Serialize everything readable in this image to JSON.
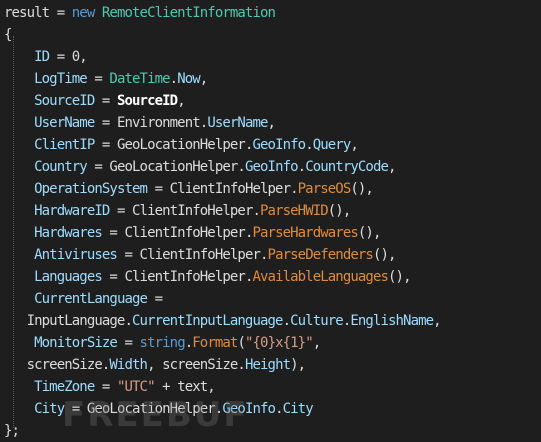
{
  "colors": {
    "background": "#1e1e1e",
    "plain": "#dcdcdc",
    "property": "#9cdcfe",
    "type": "#4ec9b0",
    "keyword": "#569cd6",
    "method": "#e08b3a",
    "string": "#d69d85"
  },
  "watermark": {
    "text": "FREEBUF",
    "style": "logo-watermark"
  },
  "code_lines": [
    [
      {
        "t": "result = ",
        "c": "plain"
      },
      {
        "t": "new",
        "c": "kw"
      },
      {
        "t": " ",
        "c": "plain"
      },
      {
        "t": "RemoteClientInformation",
        "c": "type"
      }
    ],
    [
      {
        "t": "{",
        "c": "plain"
      }
    ],
    [
      {
        "t": "    ",
        "c": "plain"
      },
      {
        "t": "ID",
        "c": "prop"
      },
      {
        "t": " = 0,",
        "c": "plain"
      }
    ],
    [
      {
        "t": "    ",
        "c": "plain"
      },
      {
        "t": "LogTime",
        "c": "prop"
      },
      {
        "t": " = ",
        "c": "plain"
      },
      {
        "t": "DateTime",
        "c": "type"
      },
      {
        "t": ".",
        "c": "plain"
      },
      {
        "t": "Now",
        "c": "prop"
      },
      {
        "t": ",",
        "c": "plain"
      }
    ],
    [
      {
        "t": "    ",
        "c": "plain"
      },
      {
        "t": "SourceID",
        "c": "prop"
      },
      {
        "t": " = ",
        "c": "plain"
      },
      {
        "t": "SourceID",
        "c": "bold"
      },
      {
        "t": ",",
        "c": "plain"
      }
    ],
    [
      {
        "t": "    ",
        "c": "plain"
      },
      {
        "t": "UserName",
        "c": "prop"
      },
      {
        "t": " = ",
        "c": "plain"
      },
      {
        "t": "Environment",
        "c": "plain"
      },
      {
        "t": ".",
        "c": "plain"
      },
      {
        "t": "UserName",
        "c": "prop"
      },
      {
        "t": ",",
        "c": "plain"
      }
    ],
    [
      {
        "t": "    ",
        "c": "plain"
      },
      {
        "t": "ClientIP",
        "c": "prop"
      },
      {
        "t": " = ",
        "c": "plain"
      },
      {
        "t": "GeoLocationHelper",
        "c": "plain"
      },
      {
        "t": ".",
        "c": "plain"
      },
      {
        "t": "GeoInfo",
        "c": "prop"
      },
      {
        "t": ".",
        "c": "plain"
      },
      {
        "t": "Query",
        "c": "prop"
      },
      {
        "t": ",",
        "c": "plain"
      }
    ],
    [
      {
        "t": "    ",
        "c": "plain"
      },
      {
        "t": "Country",
        "c": "prop"
      },
      {
        "t": " = ",
        "c": "plain"
      },
      {
        "t": "GeoLocationHelper",
        "c": "plain"
      },
      {
        "t": ".",
        "c": "plain"
      },
      {
        "t": "GeoInfo",
        "c": "prop"
      },
      {
        "t": ".",
        "c": "plain"
      },
      {
        "t": "CountryCode",
        "c": "prop"
      },
      {
        "t": ",",
        "c": "plain"
      }
    ],
    [
      {
        "t": "    ",
        "c": "plain"
      },
      {
        "t": "OperationSystem",
        "c": "prop"
      },
      {
        "t": " = ",
        "c": "plain"
      },
      {
        "t": "ClientInfoHelper",
        "c": "plain"
      },
      {
        "t": ".",
        "c": "plain"
      },
      {
        "t": "ParseOS",
        "c": "meth"
      },
      {
        "t": "(),",
        "c": "plain"
      }
    ],
    [
      {
        "t": "    ",
        "c": "plain"
      },
      {
        "t": "HardwareID",
        "c": "prop"
      },
      {
        "t": " = ",
        "c": "plain"
      },
      {
        "t": "ClientInfoHelper",
        "c": "plain"
      },
      {
        "t": ".",
        "c": "plain"
      },
      {
        "t": "ParseHWID",
        "c": "meth"
      },
      {
        "t": "(),",
        "c": "plain"
      }
    ],
    [
      {
        "t": "    ",
        "c": "plain"
      },
      {
        "t": "Hardwares",
        "c": "prop"
      },
      {
        "t": " = ",
        "c": "plain"
      },
      {
        "t": "ClientInfoHelper",
        "c": "plain"
      },
      {
        "t": ".",
        "c": "plain"
      },
      {
        "t": "ParseHardwares",
        "c": "meth"
      },
      {
        "t": "(),",
        "c": "plain"
      }
    ],
    [
      {
        "t": "    ",
        "c": "plain"
      },
      {
        "t": "Antiviruses",
        "c": "prop"
      },
      {
        "t": " = ",
        "c": "plain"
      },
      {
        "t": "ClientInfoHelper",
        "c": "plain"
      },
      {
        "t": ".",
        "c": "plain"
      },
      {
        "t": "ParseDefenders",
        "c": "meth"
      },
      {
        "t": "(),",
        "c": "plain"
      }
    ],
    [
      {
        "t": "    ",
        "c": "plain"
      },
      {
        "t": "Languages",
        "c": "prop"
      },
      {
        "t": " = ",
        "c": "plain"
      },
      {
        "t": "ClientInfoHelper",
        "c": "plain"
      },
      {
        "t": ".",
        "c": "plain"
      },
      {
        "t": "AvailableLanguages",
        "c": "meth"
      },
      {
        "t": "(),",
        "c": "plain"
      }
    ],
    [
      {
        "t": "    ",
        "c": "plain"
      },
      {
        "t": "CurrentLanguage",
        "c": "prop"
      },
      {
        "t": " =",
        "c": "plain"
      }
    ],
    [
      {
        "t": "   InputLanguage",
        "c": "plain"
      },
      {
        "t": ".",
        "c": "plain"
      },
      {
        "t": "CurrentInputLanguage",
        "c": "prop"
      },
      {
        "t": ".",
        "c": "plain"
      },
      {
        "t": "Culture",
        "c": "prop"
      },
      {
        "t": ".",
        "c": "plain"
      },
      {
        "t": "EnglishName",
        "c": "prop"
      },
      {
        "t": ",",
        "c": "plain"
      }
    ],
    [
      {
        "t": "    ",
        "c": "plain"
      },
      {
        "t": "MonitorSize",
        "c": "prop"
      },
      {
        "t": " = ",
        "c": "plain"
      },
      {
        "t": "string",
        "c": "kw"
      },
      {
        "t": ".",
        "c": "plain"
      },
      {
        "t": "Format",
        "c": "meth"
      },
      {
        "t": "(",
        "c": "plain"
      },
      {
        "t": "\"{0}x{1}\"",
        "c": "str"
      },
      {
        "t": ",",
        "c": "plain"
      }
    ],
    [
      {
        "t": "   screenSize",
        "c": "plain"
      },
      {
        "t": ".",
        "c": "plain"
      },
      {
        "t": "Width",
        "c": "prop"
      },
      {
        "t": ", screenSize",
        "c": "plain"
      },
      {
        "t": ".",
        "c": "plain"
      },
      {
        "t": "Height",
        "c": "prop"
      },
      {
        "t": "),",
        "c": "plain"
      }
    ],
    [
      {
        "t": "    ",
        "c": "plain"
      },
      {
        "t": "TimeZone",
        "c": "prop"
      },
      {
        "t": " = ",
        "c": "plain"
      },
      {
        "t": "\"UTC\"",
        "c": "str"
      },
      {
        "t": " + text,",
        "c": "plain"
      }
    ],
    [
      {
        "t": "    ",
        "c": "plain"
      },
      {
        "t": "City",
        "c": "prop"
      },
      {
        "t": " = ",
        "c": "plain"
      },
      {
        "t": "GeoLocationHelper",
        "c": "plain"
      },
      {
        "t": ".",
        "c": "plain"
      },
      {
        "t": "GeoInfo",
        "c": "prop"
      },
      {
        "t": ".",
        "c": "plain"
      },
      {
        "t": "City",
        "c": "prop"
      }
    ],
    [
      {
        "t": "};",
        "c": "plain"
      }
    ]
  ]
}
